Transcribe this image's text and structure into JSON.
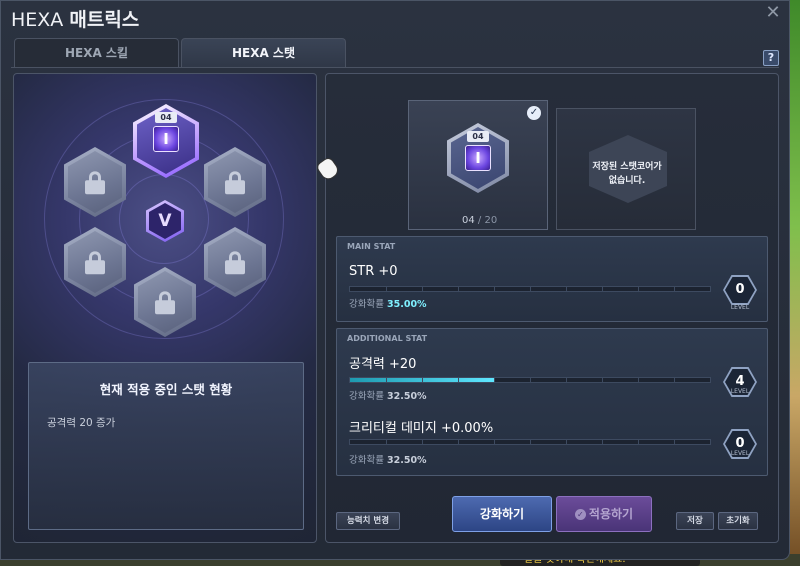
{
  "window": {
    "title_prefix": "HEXA",
    "title_main": "매트릭스",
    "close_symbol": "✕",
    "help_symbol": "?"
  },
  "tabs": [
    {
      "label": "HEXA 스킬",
      "active": false
    },
    {
      "label": "HEXA 스탯",
      "active": true
    }
  ],
  "left": {
    "core_level_tag": "04",
    "center_symbol": "V",
    "status_title": "현재 적용 중인 스탯 현황",
    "status_text": "공격력 20 증가"
  },
  "slots": {
    "main_core_level_tag": "04",
    "empty_slot_text_line1": "저장된 스탯코어가",
    "empty_slot_text_line2": "없습니다.",
    "level_current": "04",
    "level_separator": "/",
    "level_max": "20"
  },
  "main_stat": {
    "section_label": "MAIN STAT",
    "name": "STR +0",
    "rate_label": "강화확률",
    "rate_value": "35.00%",
    "level": "0",
    "level_word": "LEVEL",
    "progress_fraction": 0
  },
  "additional_stat": {
    "section_label": "ADDITIONAL STAT",
    "stats": [
      {
        "name": "공격력 +20",
        "rate_label": "강화확률",
        "rate_value": "32.50%",
        "level": "4",
        "level_word": "LEVEL",
        "progress_fraction": 0.4
      },
      {
        "name": "크리티컬 데미지 +0.00%",
        "rate_label": "강화확률",
        "rate_value": "32.50%",
        "level": "0",
        "level_word": "LEVEL",
        "progress_fraction": 0
      }
    ]
  },
  "buttons": {
    "stat_change": "능력치 변경",
    "enhance": "강화하기",
    "apply": "적용하기",
    "save": "저장",
    "reset": "초기화"
  },
  "bottom_hint": "알을 찾아내 확인해세요.",
  "colors": {
    "accent_cyan": "#5fe6ff",
    "enhance_blue": "#2d4585",
    "apply_purple": "#4a3478"
  }
}
